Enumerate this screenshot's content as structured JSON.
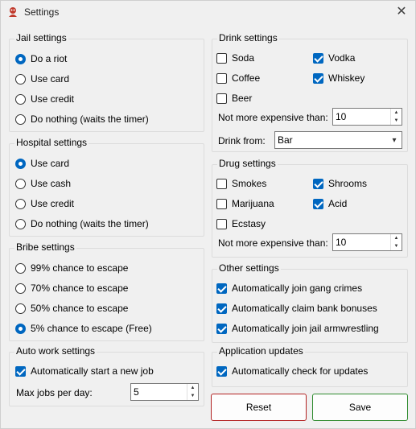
{
  "window": {
    "title": "Settings"
  },
  "jail": {
    "title": "Jail settings",
    "options": [
      "Do a riot",
      "Use card",
      "Use credit",
      "Do nothing (waits the timer)"
    ],
    "selected": 0
  },
  "hospital": {
    "title": "Hospital settings",
    "options": [
      "Use card",
      "Use cash",
      "Use credit",
      "Do nothing (waits the timer)"
    ],
    "selected": 0
  },
  "bribe": {
    "title": "Bribe settings",
    "options": [
      "99% chance to escape",
      "70% chance to escape",
      "50% chance to escape",
      "5% chance to escape (Free)"
    ],
    "selected": 3
  },
  "autowork": {
    "title": "Auto work settings",
    "auto_start_label": "Automatically start a new job",
    "auto_start_checked": true,
    "max_jobs_label": "Max jobs per day:",
    "max_jobs_value": "5"
  },
  "drink": {
    "title": "Drink settings",
    "items": [
      {
        "label": "Soda",
        "checked": false
      },
      {
        "label": "Vodka",
        "checked": true
      },
      {
        "label": "Coffee",
        "checked": false
      },
      {
        "label": "Whiskey",
        "checked": true
      },
      {
        "label": "Beer",
        "checked": false
      }
    ],
    "max_price_label": "Not more expensive than:",
    "max_price_value": "10",
    "drink_from_label": "Drink from:",
    "drink_from_value": "Bar"
  },
  "drug": {
    "title": "Drug settings",
    "items": [
      {
        "label": "Smokes",
        "checked": false
      },
      {
        "label": "Shrooms",
        "checked": true
      },
      {
        "label": "Marijuana",
        "checked": false
      },
      {
        "label": "Acid",
        "checked": true
      },
      {
        "label": "Ecstasy",
        "checked": false
      }
    ],
    "max_price_label": "Not more expensive than:",
    "max_price_value": "10"
  },
  "other": {
    "title": "Other settings",
    "items": [
      {
        "label": "Automatically join gang crimes",
        "checked": true
      },
      {
        "label": "Automatically claim bank bonuses",
        "checked": true
      },
      {
        "label": "Automatically join jail armwrestling",
        "checked": true
      }
    ]
  },
  "updates": {
    "title": "Application updates",
    "auto_check_label": "Automatically check for updates",
    "auto_check_checked": true
  },
  "buttons": {
    "reset": "Reset",
    "save": "Save"
  },
  "colors": {
    "accent": "#0067c0",
    "reset_border": "#b22222",
    "save_border": "#2e8b2e"
  }
}
